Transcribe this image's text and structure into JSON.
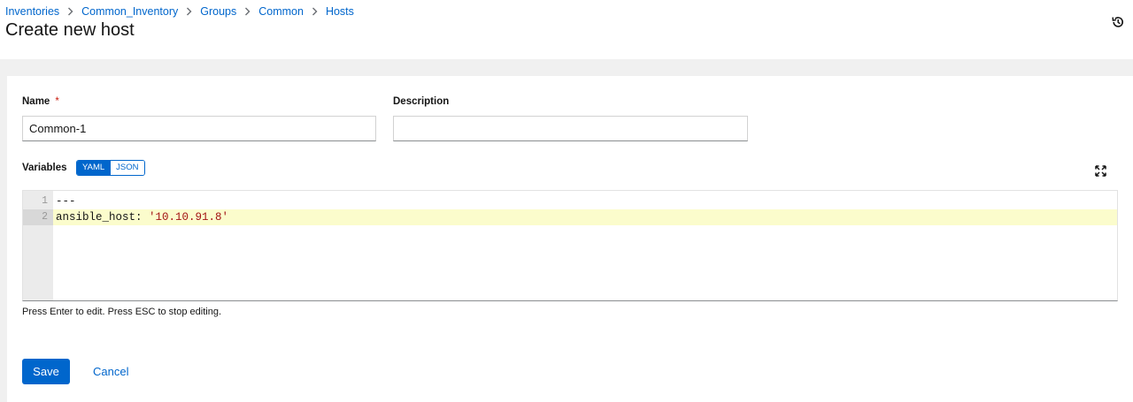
{
  "breadcrumb": {
    "items": [
      "Inventories",
      "Common_Inventory",
      "Groups",
      "Common",
      "Hosts"
    ]
  },
  "page_title": "Create new host",
  "form": {
    "name_label": "Name",
    "required_mark": "*",
    "name_value": "Common-1",
    "description_label": "Description",
    "description_value": "",
    "variables_label": "Variables",
    "format_options": [
      "YAML",
      "JSON"
    ],
    "format_selected": "YAML",
    "editor": {
      "lines": [
        {
          "number": "1",
          "text": "---"
        },
        {
          "number": "2",
          "key": "ansible_host: ",
          "value": "'10.10.91.8'"
        }
      ],
      "active_line": 2
    },
    "editor_hint": "Press Enter to edit. Press ESC to stop editing."
  },
  "actions": {
    "save_label": "Save",
    "cancel_label": "Cancel"
  },
  "colors": {
    "primary": "#0066cc",
    "required": "#c9190b",
    "string_token": "#a31515",
    "active_line": "#fbfccc"
  },
  "icons": {
    "history": "history-icon",
    "expand": "expand-icon",
    "separator": "chevron-right-icon"
  }
}
